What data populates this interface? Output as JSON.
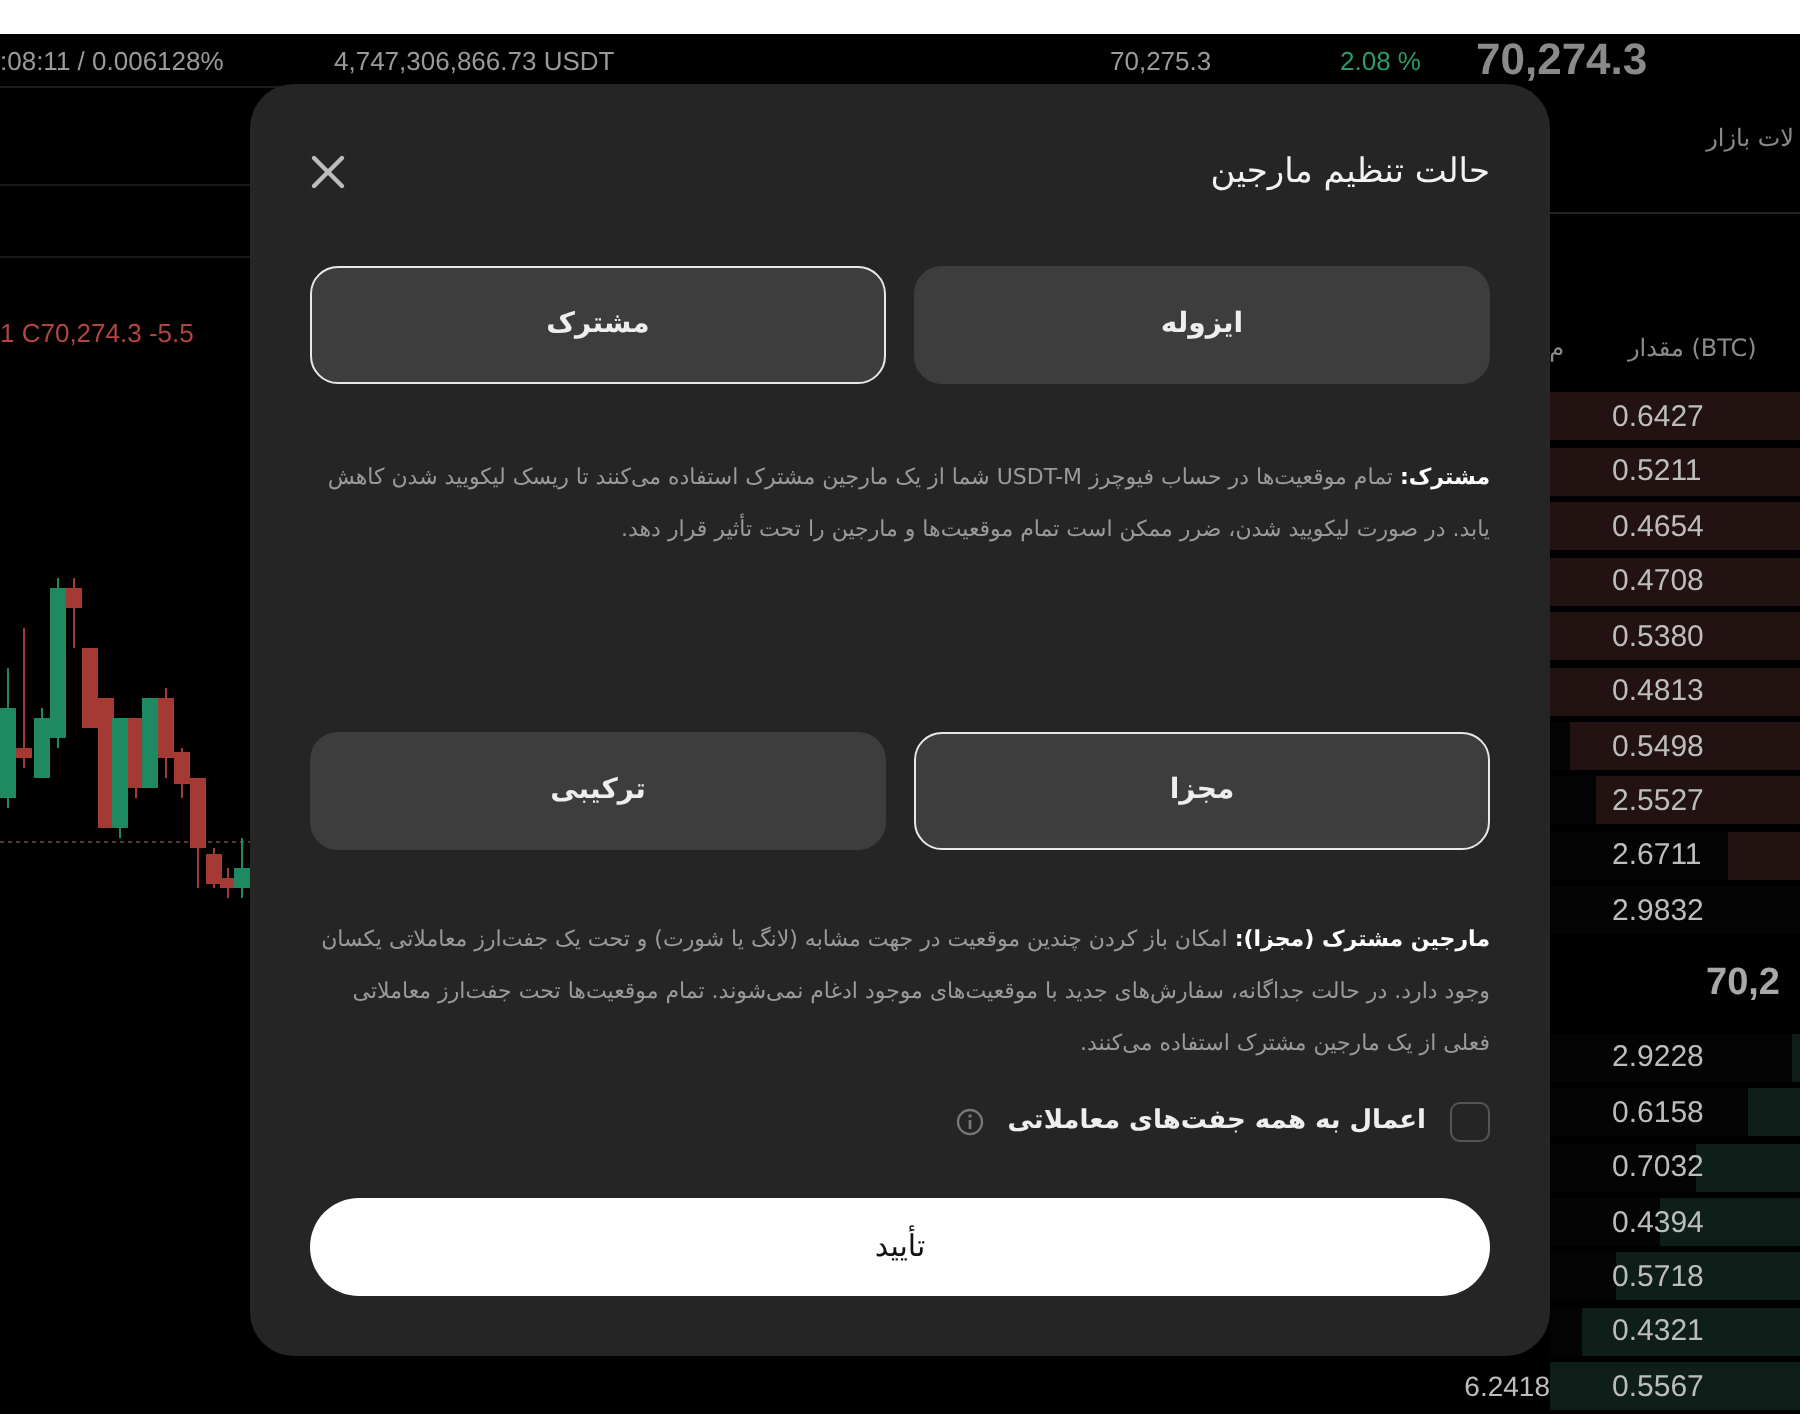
{
  "ticker": {
    "last_price": "70,274.3",
    "items": [
      {
        "text": "2.08 %",
        "kind": "up"
      },
      {
        "text": "70,275.3",
        "kind": "plain"
      },
      {
        "text": "4,747,306,866.73 USDT",
        "kind": "plain"
      },
      {
        "text": ":08:11 / 0.006128%",
        "kind": "plain"
      }
    ]
  },
  "chart": {
    "ohlc_label": "1  C70,274.3  -5.5"
  },
  "order_book": {
    "tab": "لات بازار",
    "columns": [
      "مقدار (BTC)",
      "م"
    ],
    "asks": [
      {
        "amount": "0.6427",
        "level": 1
      },
      {
        "amount": "0.5211",
        "level": 1
      },
      {
        "amount": "0.4654",
        "level": 1
      },
      {
        "amount": "0.4708",
        "level": 1
      },
      {
        "amount": "0.5380",
        "level": 1
      },
      {
        "amount": "0.4813",
        "level": 1
      },
      {
        "amount": "0.5498",
        "level": 0.92
      },
      {
        "amount": "2.5527",
        "level": 0.82
      },
      {
        "amount": "2.6711",
        "level": 0.29
      },
      {
        "amount": "2.9832"
      }
    ],
    "mid_price": "70,2",
    "bids": [
      {
        "amount": "2.9228",
        "level": 0.03
      },
      {
        "amount": "0.6158",
        "level": 0.21
      },
      {
        "amount": "0.7032",
        "level": 0.42
      },
      {
        "amount": "0.4394",
        "level": 0.56
      },
      {
        "amount": "0.5718",
        "level": 0.74
      },
      {
        "amount": "0.4321",
        "level": 0.87
      },
      {
        "amount": "0.5567",
        "level": 1,
        "total": "6.2418"
      }
    ]
  },
  "dialog": {
    "title": "حالت تنظیم مارجین",
    "groups": [
      {
        "options": [
          {
            "label": "ایزوله",
            "selected": false
          },
          {
            "label": "مشترک",
            "selected": true
          }
        ],
        "description": "**مشترک:** تمام موقعیت‌ها در حساب فیوچرز USDT-M شما از یک مارجین مشترک استفاده می‌کنند تا ریسک لیکویید شدن کاهش یابد. در صورت لیکویید شدن، ضرر ممکن است تمام موقعیت‌ها و مارجین را تحت تأثیر قرار دهد."
      },
      {
        "options": [
          {
            "label": "مجزا",
            "selected": true
          },
          {
            "label": "ترکیبی",
            "selected": false
          }
        ],
        "description": "**مارجین مشترک (مجزا):** امکان باز کردن چندین موقعیت در جهت مشابه (لانگ یا شورت) و تحت یک جفت‌ارز معاملاتی یکسان وجود دارد. در حالت جداگانه، سفارش‌های جدید با موقعیت‌های موجود ادغام نمی‌شوند. تمام موقعیت‌ها تحت جفت‌ارز معاملاتی فعلی از یک مارجین مشترک استفاده می‌کنند."
      }
    ],
    "apply_all": {
      "label": "اعمال به همه جفت‌های معاملاتی",
      "checked": false
    },
    "confirm": "تأیید"
  }
}
